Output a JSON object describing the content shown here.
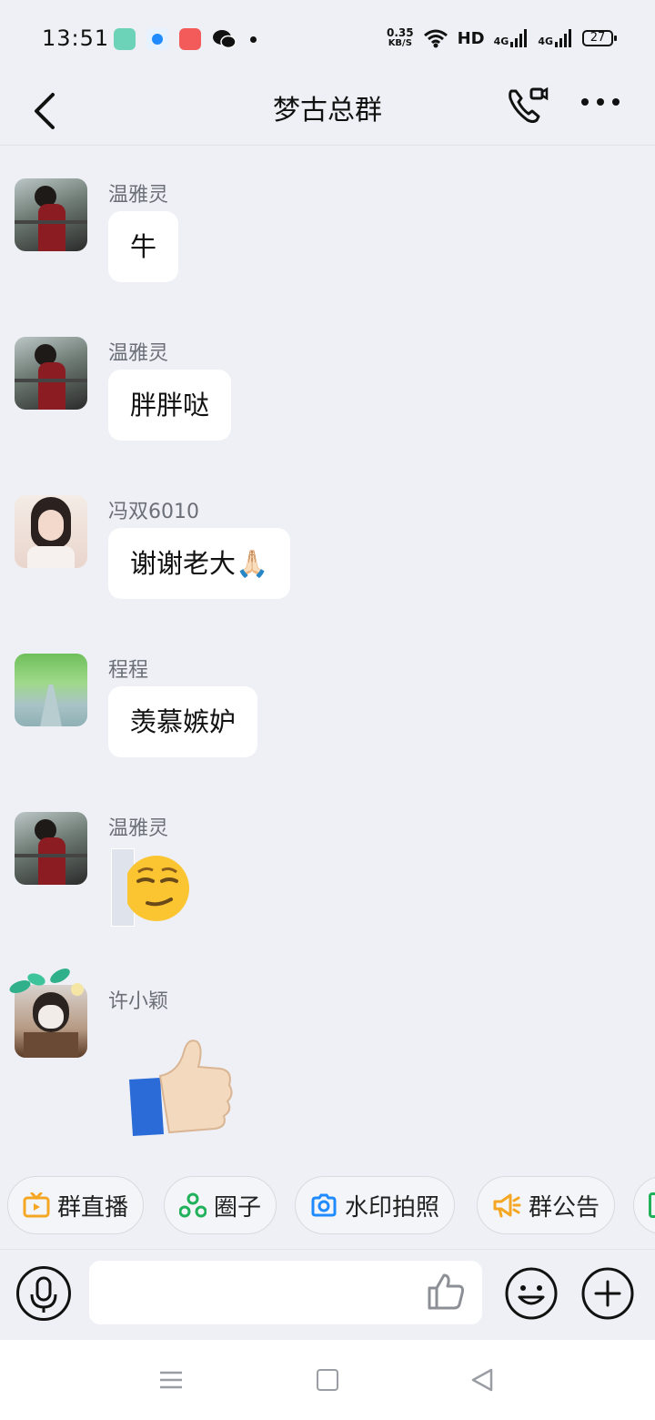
{
  "status_bar": {
    "time": "13:51",
    "net_speed_value": "0.35",
    "net_speed_unit": "KB/S",
    "hd_label": "HD",
    "signal_1": "4G",
    "signal_2": "4G",
    "battery": "27",
    "app_icons": [
      "app-icon-green",
      "app-icon-blue",
      "app-icon-red",
      "wechat-icon"
    ]
  },
  "header": {
    "title": "梦古总群",
    "icons": [
      "back-arrow-icon",
      "phone-video-call-icon",
      "more-dots-icon"
    ]
  },
  "messages": [
    {
      "sender": "温雅灵",
      "text": "牛",
      "avatar": "avatar-woman-red-dress"
    },
    {
      "sender": "温雅灵",
      "text": "胖胖哒",
      "avatar": "avatar-woman-red-dress"
    },
    {
      "sender": "冯双6010",
      "text": "谢谢老大🙏🏻",
      "avatar": "avatar-woman-portrait"
    },
    {
      "sender": "程程",
      "text": "羡慕嫉妒",
      "avatar": "avatar-green-park-road"
    },
    {
      "sender": "温雅灵",
      "sticker": "smirk-face-emoji",
      "avatar": "avatar-woman-red-dress"
    },
    {
      "sender": "许小颖",
      "sticker": "thumbs-up-emoji",
      "avatar": "avatar-masked-girl"
    }
  ],
  "quick_actions": [
    {
      "label": "群直播",
      "icon": "tv-icon",
      "color": "#f5a623"
    },
    {
      "label": "圈子",
      "icon": "circle-nodes-icon",
      "color": "#20b15a"
    },
    {
      "label": "水印拍照",
      "icon": "camera-icon",
      "color": "#1f8bff"
    },
    {
      "label": "群公告",
      "icon": "megaphone-icon",
      "color": "#f5a623"
    }
  ],
  "input_bar": {
    "placeholder": "",
    "icons": [
      "microphone-icon",
      "thumbs-up-icon",
      "emoji-smile-icon",
      "plus-icon"
    ]
  },
  "nav_bar": {
    "icons": [
      "menu-icon",
      "home-square-icon",
      "back-triangle-icon"
    ]
  },
  "colors": {
    "background": "#eef0f5",
    "bubble": "#ffffff",
    "sender_name": "#6b6f77"
  }
}
